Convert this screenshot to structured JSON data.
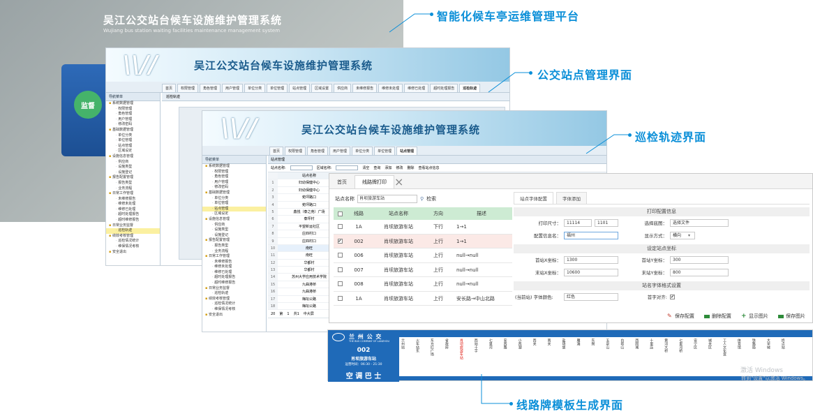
{
  "callouts": {
    "platform": "智能化候车亭运维管理平台",
    "station_mgmt": "公交站点管理界面",
    "patrol_track": "巡检轨迹界面",
    "route_sign": "线路牌模板生成界面"
  },
  "login": {
    "title": "吴江公交站台候车设施维护管理系统",
    "subtitle": "Wujiang bus station waiting facilities maintenance management system",
    "badge": "监督"
  },
  "window1": {
    "system_title": "吴江公交站台候车设施维护管理系统",
    "tabs": [
      "首页",
      "权限管理",
      "角色管理",
      "用户管理",
      "单位分类",
      "单位管理",
      "站点管理",
      "区域设置",
      "供应商",
      "未维修报告",
      "维修未处理",
      "维修已处理",
      "超时处理报告",
      "巡检轨迹"
    ],
    "active_tab": 13,
    "nav_header": "导航菜单",
    "nav_items": [
      {
        "label": "系统数据管理",
        "level": 1
      },
      {
        "label": "权限管理",
        "level": 2
      },
      {
        "label": "角色管理",
        "level": 2
      },
      {
        "label": "用户管理",
        "level": 2
      },
      {
        "label": "修改密码",
        "level": 2
      },
      {
        "label": "基础数据管理",
        "level": 1
      },
      {
        "label": "单位分类",
        "level": 2
      },
      {
        "label": "单位管理",
        "level": 2
      },
      {
        "label": "站点管理",
        "level": 2
      },
      {
        "label": "区域设定",
        "level": 2
      },
      {
        "label": "设施信息管理",
        "level": 1
      },
      {
        "label": "供应商",
        "level": 2
      },
      {
        "label": "设施类型",
        "level": 2
      },
      {
        "label": "设施登记",
        "level": 2
      },
      {
        "label": "报告配置管理",
        "level": 1
      },
      {
        "label": "报告类型",
        "level": 2
      },
      {
        "label": "业务流程",
        "level": 2
      },
      {
        "label": "日常工作管理",
        "level": 1
      },
      {
        "label": "未维修报告",
        "level": 2
      },
      {
        "label": "维修未处理",
        "level": 2
      },
      {
        "label": "维修已处理",
        "level": 2
      },
      {
        "label": "超时处理报告",
        "level": 2
      },
      {
        "label": "超时维修报告",
        "level": 2
      },
      {
        "label": "日常业务监督",
        "level": 1
      },
      {
        "label": "巡检轨迹",
        "level": 2
      },
      {
        "label": "绩效考核管理",
        "level": 1
      },
      {
        "label": "巡检情况统计",
        "level": 2
      },
      {
        "label": "维保情况考核",
        "level": 2
      },
      {
        "label": "安全退出",
        "level": 1
      }
    ],
    "selected_nav": 24,
    "content_header": "巡检轨迹"
  },
  "window2": {
    "system_title": "吴江公交站台候车设施维护管理系统",
    "tabs": [
      "首页",
      "权限管理",
      "角色管理",
      "用户管理",
      "单位分类",
      "单位管理",
      "站点管理"
    ],
    "active_tab": 6,
    "nav_header": "导航菜单",
    "nav_items": [
      {
        "label": "系统数据管理",
        "level": 1
      },
      {
        "label": "权限管理",
        "level": 2
      },
      {
        "label": "角色管理",
        "level": 2
      },
      {
        "label": "用户管理",
        "level": 2
      },
      {
        "label": "修改密码",
        "level": 2
      },
      {
        "label": "基础数据管理",
        "level": 1
      },
      {
        "label": "单位分类",
        "level": 2
      },
      {
        "label": "单位管理",
        "level": 2
      },
      {
        "label": "站点管理",
        "level": 2
      },
      {
        "label": "区域设定",
        "level": 2
      },
      {
        "label": "设施信息管理",
        "level": 1
      },
      {
        "label": "供应商",
        "level": 2
      },
      {
        "label": "设施类型",
        "level": 2
      },
      {
        "label": "设施登记",
        "level": 2
      },
      {
        "label": "报告配置管理",
        "level": 1
      },
      {
        "label": "报告类型",
        "level": 2
      },
      {
        "label": "业务流程",
        "level": 2
      },
      {
        "label": "日常工作管理",
        "level": 1
      },
      {
        "label": "未维修报告",
        "level": 2
      },
      {
        "label": "维修未处理",
        "level": 2
      },
      {
        "label": "维修已处理",
        "level": 2
      },
      {
        "label": "超时处理报告",
        "level": 2
      },
      {
        "label": "超时维修报告",
        "level": 2
      },
      {
        "label": "日常业务监督",
        "level": 1
      },
      {
        "label": "巡检轨迹",
        "level": 2
      },
      {
        "label": "绩效考核管理",
        "level": 1
      },
      {
        "label": "巡检情况统计",
        "level": 2
      },
      {
        "label": "维保情况考核",
        "level": 2
      },
      {
        "label": "安全退出",
        "level": 1
      }
    ],
    "selected_nav": 8,
    "grid_title": "站点管理",
    "toolbar": {
      "station_label": "站点名称:",
      "area_label": "区域名称:",
      "clear": "清空",
      "query": "查询",
      "add": "添加",
      "edit": "修改",
      "delete": "删除",
      "view": "查看站点信息"
    },
    "column_header": "站点名称",
    "rows": [
      "妇幼保健中心",
      "妇幼保健中心",
      "菀坪路口",
      "菀坪路口",
      "鑫悦（泰之苑）广场",
      "泰坪村",
      "平望新运社区",
      "庄四村口",
      "庄四村口",
      "南旺",
      "南旺",
      "华都村",
      "华都村",
      "苏州大学应用技术学院",
      "九曲港桥",
      "九曲港桥",
      "梅坛公路",
      "梅坛公路"
    ],
    "pager": {
      "page_label": "第",
      "page": "1",
      "of_label": "共1",
      "size": "20"
    },
    "footer": "中大屏"
  },
  "window3": {
    "tabs": [
      "首页",
      "线路牌打印"
    ],
    "active_tab": 1,
    "search_label": "站点名称",
    "search_value": "肖坝旅游车站",
    "search_button": "检索",
    "columns": [
      "线路",
      "站点名称",
      "方向",
      "描述"
    ],
    "rows": [
      {
        "checked": false,
        "line": "1A",
        "station": "肖坝旅游车站",
        "direction": "下行",
        "desc": "1→1"
      },
      {
        "checked": true,
        "line": "002",
        "station": "肖坝旅游车站",
        "direction": "上行",
        "desc": "1→1"
      },
      {
        "checked": false,
        "line": "006",
        "station": "肖坝旅游车站",
        "direction": "上行",
        "desc": "null→null"
      },
      {
        "checked": false,
        "line": "007",
        "station": "肖坝旅游车站",
        "direction": "上行",
        "desc": "null→null"
      },
      {
        "checked": false,
        "line": "008",
        "station": "肖坝旅游车站",
        "direction": "上行",
        "desc": "null→null"
      },
      {
        "checked": false,
        "line": "1A",
        "station": "肖坝旅游车站",
        "direction": "上行",
        "desc": "安长路→中山北路"
      }
    ],
    "settings_tabs": [
      "站点字体配置",
      "字体添加"
    ],
    "print_section": "打印配置信息",
    "print_size_label": "打印尺寸：",
    "print_size_w": "11114",
    "print_size_h": "1101",
    "bg_label": "选择底图：",
    "bg_button": "选择文件",
    "config_name_label": "配置信息名：",
    "config_name": "福州",
    "show_mode_label": "显示方式：",
    "show_mode": "横向",
    "coord_section": "设定站点坐标",
    "first_x_label": "首站X坐标：",
    "first_x": "1300",
    "first_y_label": "首站Y坐标：",
    "first_y": "300",
    "last_x_label": "末站X坐标：",
    "last_x": "10600",
    "last_y_label": "末站Y坐标：",
    "last_y": "800",
    "font_section": "站名字体格式设置",
    "font_color_label": "(当前站) 字体颜色:",
    "font_color": "红色",
    "first_align_label": "首字对齐:",
    "first_align_checked": true,
    "buttons": {
      "save_config": "保存配置",
      "delete_config": "删除配置",
      "show_image": "显示图片",
      "save_image": "保存图片"
    }
  },
  "route_sign": {
    "company": "兰 州 公 交",
    "company_en": "THE BUS COMPANY OF LANZHOU",
    "line": "002",
    "current_stop": "肖坝旅游车站",
    "hours": "运营时间：06:30 - 21:30",
    "bus_type": "空 调 巴 士",
    "stops": [
      "兰州站",
      "火车站东",
      "东方红广场",
      "省政府",
      "肖坝旅游车站",
      "西站十字",
      "七里河",
      "安西路",
      "小西湖",
      "西关",
      "南关",
      "盐场堡",
      "雁滩",
      "东岗",
      "五泉山",
      "白塔山",
      "西固城",
      "十里店",
      "黄河大桥",
      "七里河桥",
      "安宁区",
      "城关区",
      "工人文化宫",
      "体育馆",
      "铁路局",
      "大学城",
      "终点站"
    ],
    "current_index": 4,
    "watermark": "激活 Windows",
    "watermark_sub": "转到\"设置\"以激活 Windows。"
  }
}
